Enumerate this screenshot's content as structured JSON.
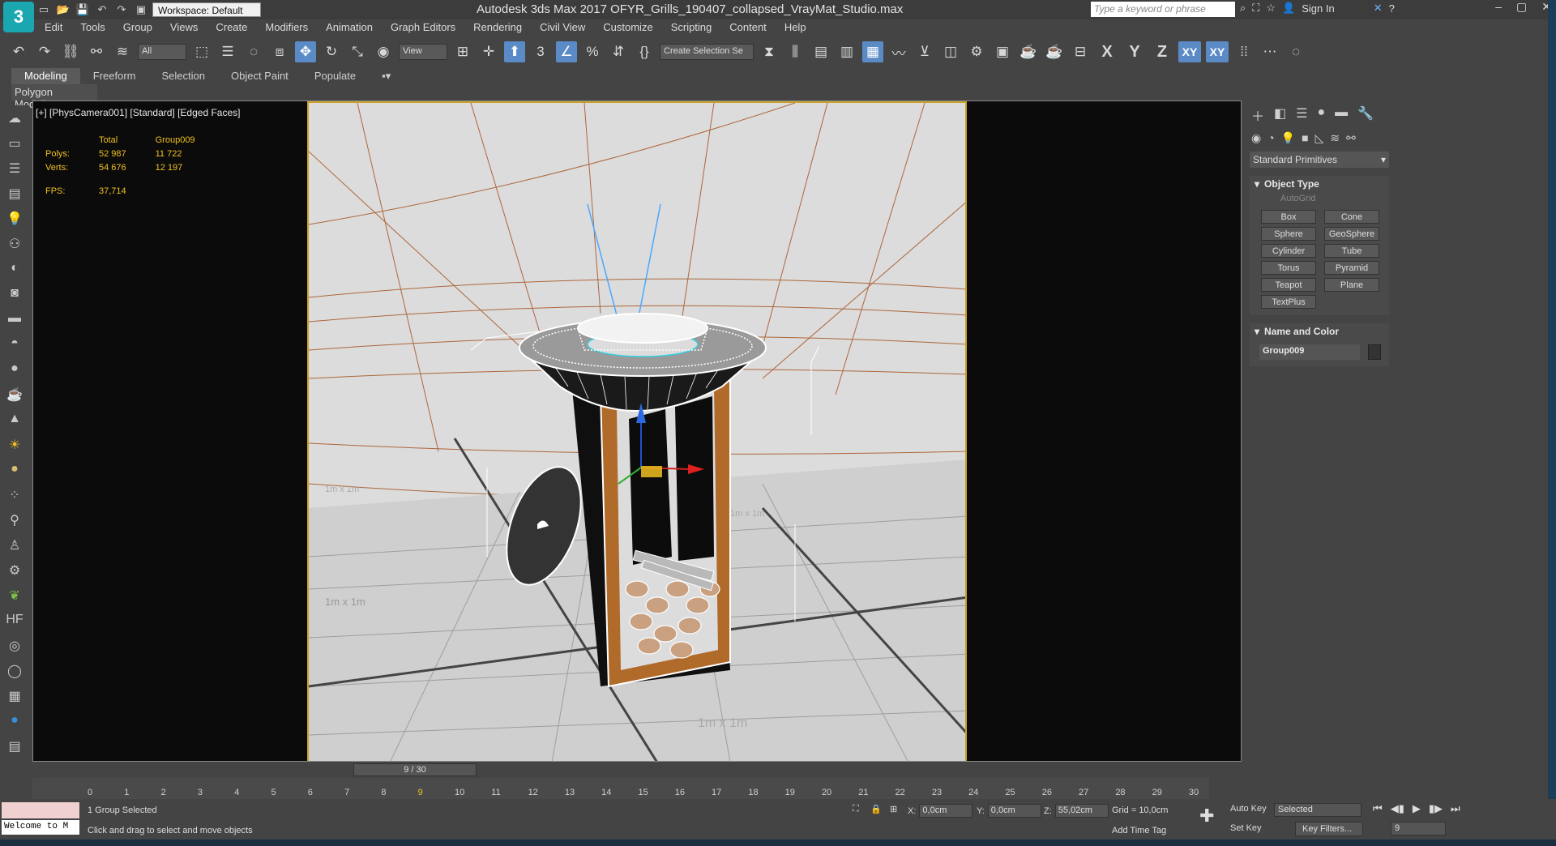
{
  "titlebar": {
    "app_logo": "3",
    "workspace": "Workspace: Default",
    "title": "Autodesk 3ds Max 2017    OFYR_Grills_190407_collapsed_VrayMat_Studio.max",
    "search_placeholder": "Type a keyword or phrase",
    "sign_in": "Sign In"
  },
  "menu": [
    "Edit",
    "Tools",
    "Group",
    "Views",
    "Create",
    "Modifiers",
    "Animation",
    "Graph Editors",
    "Rendering",
    "Civil View",
    "Customize",
    "Scripting",
    "Content",
    "Help"
  ],
  "toolbar": {
    "filter": "All",
    "ref_coord": "View",
    "selection_set": "Create Selection Se",
    "axis_x": "X",
    "axis_y": "Y",
    "axis_z": "Z",
    "axis_xy": "XY",
    "axis_xy2": "XY"
  },
  "ribbon": {
    "tabs": [
      "Modeling",
      "Freeform",
      "Selection",
      "Object Paint",
      "Populate"
    ],
    "sub": "Polygon Modeling"
  },
  "viewport": {
    "label": "[+] [PhysCamera001] [Standard] [Edged Faces]",
    "stats": {
      "header_total": "Total",
      "header_group": "Group009",
      "polys_label": "Polys:",
      "polys_total": "52 987",
      "polys_group": "11 722",
      "verts_label": "Verts:",
      "verts_total": "54 676",
      "verts_group": "12 197",
      "fps_label": "FPS:",
      "fps_value": "37,714"
    },
    "grid_label": "1m x 1m"
  },
  "command_panel": {
    "dropdown": "Standard Primitives",
    "object_type_title": "Object Type",
    "autogrid": "AutoGrid",
    "buttons": [
      "Box",
      "Cone",
      "Sphere",
      "GeoSphere",
      "Cylinder",
      "Tube",
      "Torus",
      "Pyramid",
      "Teapot",
      "Plane",
      "TextPlus"
    ],
    "name_color_title": "Name and Color",
    "name_value": "Group009"
  },
  "timeline": {
    "slider": "9 / 30",
    "ticks": [
      "0",
      "1",
      "2",
      "3",
      "4",
      "5",
      "6",
      "7",
      "8",
      "9",
      "10",
      "11",
      "12",
      "13",
      "14",
      "15",
      "16",
      "17",
      "18",
      "19",
      "20",
      "21",
      "22",
      "23",
      "24",
      "25",
      "26",
      "27",
      "28",
      "29",
      "30"
    ]
  },
  "status": {
    "maxscript_welcome": "Welcome to M",
    "selected": "1 Group Selected",
    "prompt": "Click and drag to select and move objects",
    "x_label": "X:",
    "x_value": "0,0cm",
    "y_label": "Y:",
    "y_value": "0,0cm",
    "z_label": "Z:",
    "z_value": "55,02cm",
    "grid": "Grid = 10,0cm",
    "add_time_tag": "Add Time Tag",
    "auto_key": "Auto Key",
    "set_key": "Set Key",
    "selected_drop": "Selected",
    "key_filters": "Key Filters...",
    "frame": "9"
  },
  "colors": {
    "accent": "#5b8bc7",
    "stats_yellow": "#f0c020",
    "viewport_border": "#c9a227",
    "grill_rust": "#b06a2a"
  }
}
